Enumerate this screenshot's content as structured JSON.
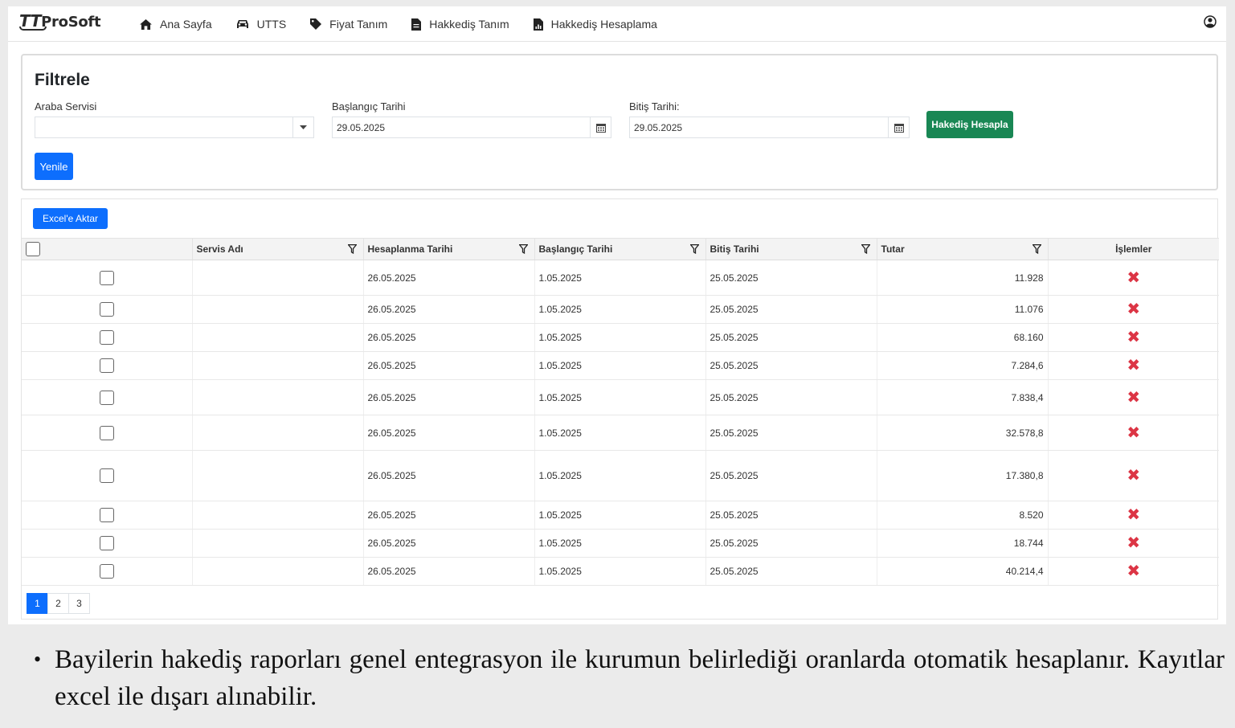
{
  "navbar": {
    "logo_tt": "TT",
    "logo_text": "ProSoft",
    "items": [
      {
        "label": "Ana Sayfa",
        "icon": "home-icon"
      },
      {
        "label": "UTTS",
        "icon": "car-icon"
      },
      {
        "label": "Fiyat Tanım",
        "icon": "tag-icon"
      },
      {
        "label": "Hakkediş Tanım",
        "icon": "document-icon"
      },
      {
        "label": "Hakkediş Hesaplama",
        "icon": "report-icon"
      }
    ],
    "user_icon": "user-circle-icon"
  },
  "filter": {
    "title": "Filtrele",
    "service_label": "Araba Servisi",
    "service_value": "",
    "start_label": "Başlangıç Tarihi",
    "start_value": "29.05.2025",
    "end_label": "Bitiş Tarihi:",
    "end_value": "29.05.2025",
    "calculate_button": "Hakediş Hesapla",
    "refresh_button": "Yenile"
  },
  "grid": {
    "export_button": "Excel'e Aktar",
    "columns": [
      "Servis Adı",
      "Hesaplanma Tarihi",
      "Başlangıç Tarihi",
      "Bitiş Tarihi",
      "Tutar",
      "İşlemler"
    ],
    "rows": [
      {
        "service": "",
        "calc_date": "26.05.2025",
        "start": "1.05.2025",
        "end": "25.05.2025",
        "amount": "11.928"
      },
      {
        "service": "",
        "calc_date": "26.05.2025",
        "start": "1.05.2025",
        "end": "25.05.2025",
        "amount": "11.076"
      },
      {
        "service": "",
        "calc_date": "26.05.2025",
        "start": "1.05.2025",
        "end": "25.05.2025",
        "amount": "68.160"
      },
      {
        "service": "",
        "calc_date": "26.05.2025",
        "start": "1.05.2025",
        "end": "25.05.2025",
        "amount": "7.284,6"
      },
      {
        "service": "",
        "calc_date": "26.05.2025",
        "start": "1.05.2025",
        "end": "25.05.2025",
        "amount": "7.838,4"
      },
      {
        "service": "",
        "calc_date": "26.05.2025",
        "start": "1.05.2025",
        "end": "25.05.2025",
        "amount": "32.578,8"
      },
      {
        "service": "",
        "calc_date": "26.05.2025",
        "start": "1.05.2025",
        "end": "25.05.2025",
        "amount": "17.380,8"
      },
      {
        "service": "",
        "calc_date": "26.05.2025",
        "start": "1.05.2025",
        "end": "25.05.2025",
        "amount": "8.520"
      },
      {
        "service": "",
        "calc_date": "26.05.2025",
        "start": "1.05.2025",
        "end": "25.05.2025",
        "amount": "18.744"
      },
      {
        "service": "",
        "calc_date": "26.05.2025",
        "start": "1.05.2025",
        "end": "25.05.2025",
        "amount": "40.214,4"
      }
    ],
    "delete_symbol": "✖",
    "pages": [
      "1",
      "2",
      "3"
    ],
    "active_page": "1"
  },
  "caption": {
    "bullet": "•",
    "text": "Bayilerin hakediş raporları genel entegrasyon ile kurumun belirlediği oranlarda otomatik hesaplanır. Kayıtlar excel ile dışarı alınabilir."
  },
  "colors": {
    "primary": "#0d6efd",
    "success": "#198754",
    "danger": "#dc3545"
  }
}
